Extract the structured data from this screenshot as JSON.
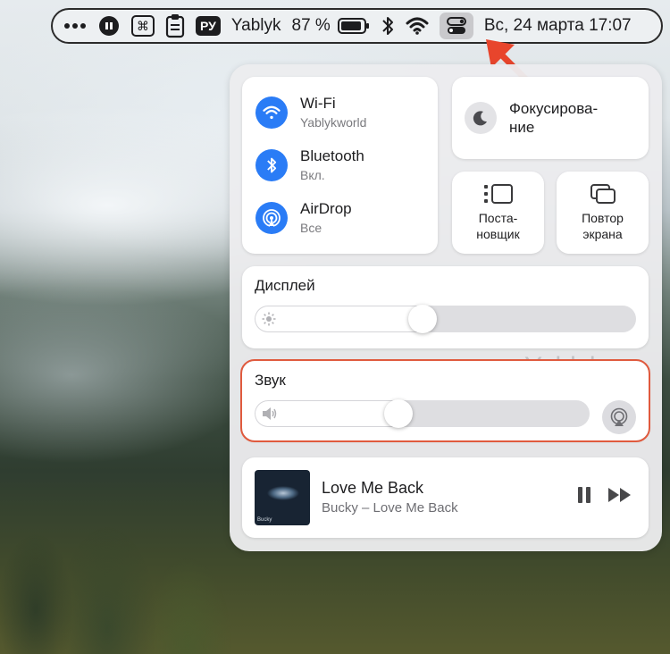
{
  "menubar": {
    "language": "РУ",
    "app_name": "Yablyk",
    "battery_percent": "87 %",
    "clock": "Вс, 24 марта  17:07"
  },
  "network": {
    "wifi": {
      "title": "Wi‑Fi",
      "subtitle": "Yablykworld"
    },
    "bluetooth": {
      "title": "Bluetooth",
      "subtitle": "Вкл."
    },
    "airdrop": {
      "title": "AirDrop",
      "subtitle": "Все"
    }
  },
  "focus": {
    "label": "Фокусирова-\nние"
  },
  "stage_manager": {
    "label": "Поста-\nновщик"
  },
  "screen_mirroring": {
    "label": "Повтор\nэкрана"
  },
  "display": {
    "label": "Дисплей",
    "brightness_percent": 44
  },
  "sound": {
    "label": "Звук",
    "volume_percent": 43
  },
  "now_playing": {
    "title": "Love Me Back",
    "subtitle": "Bucky – Love Me Back",
    "art_text": "Bucky"
  },
  "watermark": "Yablyk",
  "colors": {
    "accent": "#2a7cf6",
    "highlight": "#e05a3e",
    "arrow": "#e8452c"
  }
}
